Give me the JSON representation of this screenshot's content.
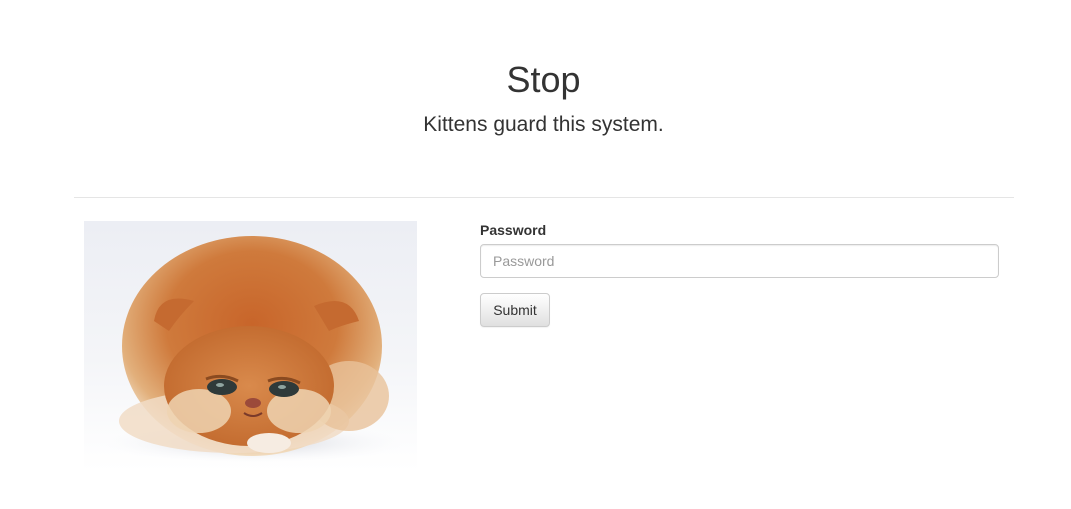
{
  "header": {
    "title": "Stop",
    "subtitle": "Kittens guard this system."
  },
  "image": {
    "icon": "kitten-photo"
  },
  "form": {
    "password_label": "Password",
    "password_placeholder": "Password",
    "password_value": "",
    "submit_label": "Submit"
  },
  "colors": {
    "text": "#333333",
    "divider": "#e5e5e5",
    "input_border": "#cccccc",
    "placeholder": "#999999"
  }
}
